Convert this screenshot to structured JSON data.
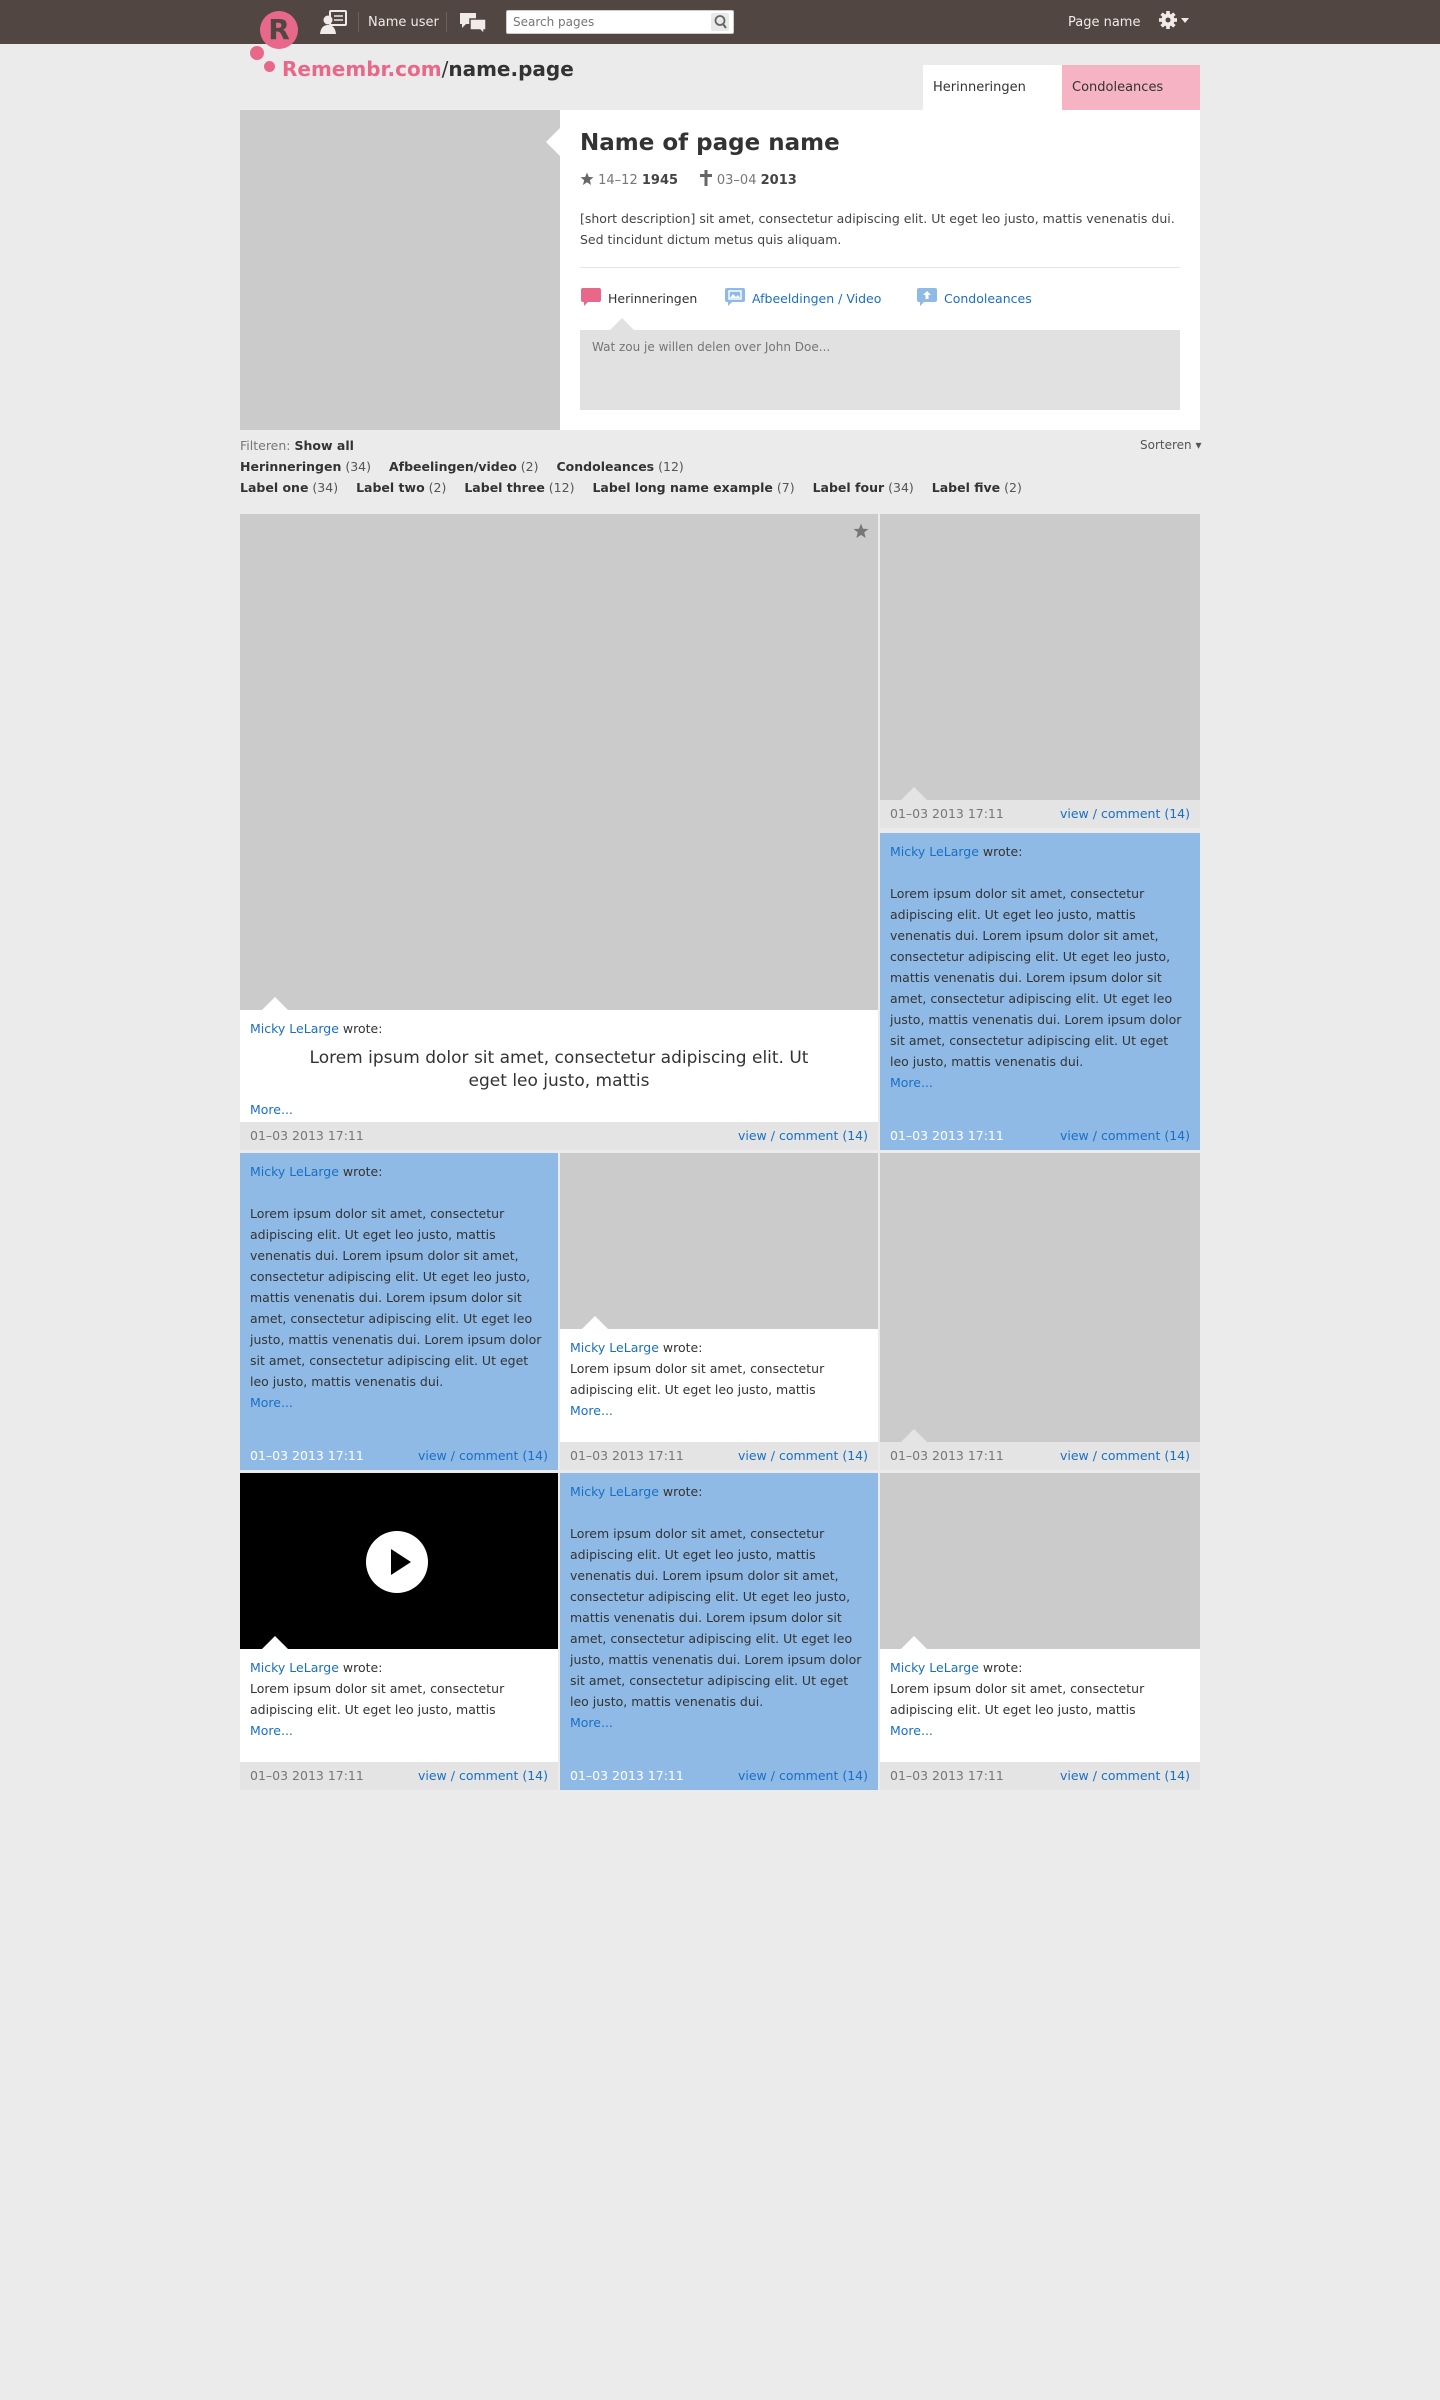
{
  "header": {
    "logo_letter": "R",
    "user_name": "Name user",
    "search_placeholder": "Search pages",
    "page_name": "Page name",
    "brand_site": "Remembr.com",
    "brand_slash": "/",
    "brand_page": "name.page"
  },
  "tabs": {
    "herinneringen": "Herinneringen (34)",
    "condoleances": "Condoleances (12)"
  },
  "profile": {
    "name": "Name of page name",
    "birth_day": "14–12",
    "birth_year": "1945",
    "death_day": "03–04",
    "death_year": "2013",
    "description": "[short description] sit amet, consectetur adipiscing elit. Ut eget leo justo, mattis venenatis dui. Sed tincidunt dictum metus quis aliquam.",
    "tab_herinneringen": "Herinneringen",
    "tab_afbeeldingen": "Afbeeldingen / Video",
    "tab_condoleances": "Condoleances",
    "share_placeholder": "Wat zou je willen delen over John Doe..."
  },
  "filters": {
    "label": "Filteren:",
    "show_all": "Show all",
    "sort": "Sorteren",
    "types": [
      {
        "name": "Herinneringen",
        "count": "(34)"
      },
      {
        "name": "Afbeelingen/video",
        "count": "(2)"
      },
      {
        "name": "Condoleances",
        "count": "(12)"
      }
    ],
    "labels": [
      {
        "name": "Label one",
        "count": "(34)"
      },
      {
        "name": "Label two",
        "count": "(2)"
      },
      {
        "name": "Label three",
        "count": "(12)"
      },
      {
        "name": "Label long name example",
        "count": "(7)"
      },
      {
        "name": "Label four",
        "count": "(34)"
      },
      {
        "name": "Label five",
        "count": "(2)"
      }
    ]
  },
  "post": {
    "author": "Micky LeLarge",
    "wrote": "wrote:",
    "more": "More...",
    "timestamp": "01–03 2013 17:11",
    "view": "view",
    "slash": "/",
    "comment": "comment (14)",
    "quote": "Lorem ipsum dolor sit amet, consectetur adipiscing elit. Ut eget leo justo, mattis",
    "short_text": "Lorem ipsum dolor sit amet, consectetur adipiscing elit. Ut eget leo justo, mattis",
    "long_text": "Lorem ipsum dolor sit amet, consectetur adipiscing elit. Ut eget leo justo, mattis venenatis dui.  Lorem ipsum dolor sit amet, consectetur adipiscing elit. Ut eget leo justo, mattis venenatis dui. Lorem ipsum dolor sit amet, consectetur adipiscing elit. Ut eget leo justo, mattis venenatis dui. Lorem ipsum dolor sit amet, consectetur adipiscing elit. Ut eget leo justo, mattis venenatis dui."
  },
  "colors": {
    "brand_pink": "#e8688a",
    "topbar": "#514641",
    "tile_blue": "#8fbae6",
    "link_blue": "#1a6fc4"
  },
  "icons": [
    "logo-icon",
    "user-profile-icon",
    "chat-icon",
    "search-icon",
    "gear-icon",
    "star-icon",
    "cross-icon",
    "speech-bubble-icon",
    "image-icon",
    "upload-icon",
    "favorite-star-icon",
    "play-icon"
  ]
}
